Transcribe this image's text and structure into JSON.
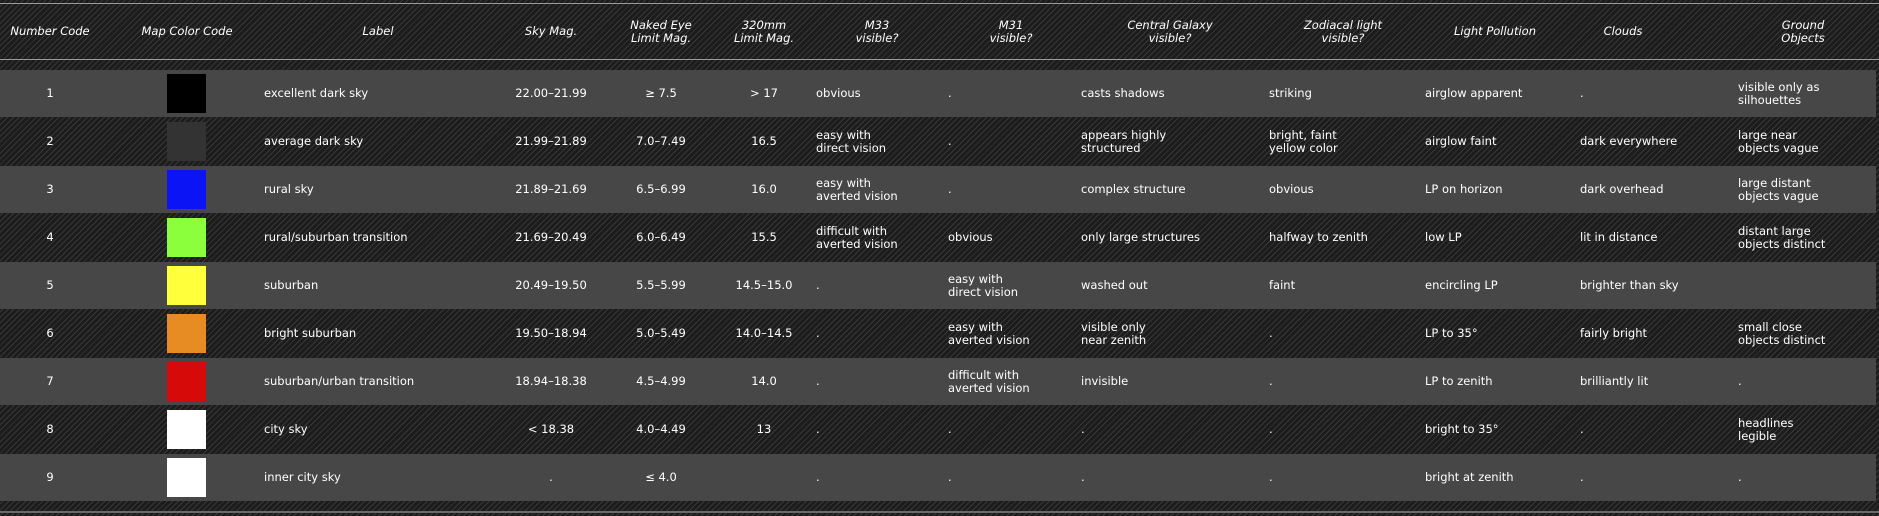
{
  "headers": [
    "Number Code",
    "Map Color Code",
    "Label",
    "Sky Mag.",
    "Naked Eye\nLimit Mag.",
    "320mm\nLimit Mag.",
    "M33\nvisible?",
    "M31\nvisible?",
    "Central Galaxy\nvisible?",
    "Zodiacal light\nvisible?",
    "Light Pollution",
    "Clouds",
    "Ground\nObjects"
  ],
  "rows": [
    {
      "number": "1",
      "color": "#000000",
      "label": "excellent dark sky",
      "sky_mag": "22.00–21.99",
      "naked_eye": "≥ 7.5",
      "limit_320mm": "> 17",
      "m33": "obvious",
      "m31": ".",
      "central_galaxy": "casts shadows",
      "zodiacal": "striking",
      "light_pollution": "airglow apparent",
      "clouds": ".",
      "ground": "visible only as\nsilhouettes"
    },
    {
      "number": "2",
      "color": "#333333",
      "label": "average dark sky",
      "sky_mag": "21.99–21.89",
      "naked_eye": "7.0–7.49",
      "limit_320mm": "16.5",
      "m33": "easy with\ndirect vision",
      "m31": ".",
      "central_galaxy": "appears highly\nstructured",
      "zodiacal": "bright, faint\nyellow color",
      "light_pollution": "airglow faint",
      "clouds": "dark everywhere",
      "ground": "large near\nobjects vague"
    },
    {
      "number": "3",
      "color": "#0a14f5",
      "label": "rural sky",
      "sky_mag": "21.89–21.69",
      "naked_eye": "6.5–6.99",
      "limit_320mm": "16.0",
      "m33": "easy with\naverted vision",
      "m31": ".",
      "central_galaxy": "complex structure",
      "zodiacal": "obvious",
      "light_pollution": "LP on horizon",
      "clouds": "dark overhead",
      "ground": "large distant\nobjects vague"
    },
    {
      "number": "4",
      "color": "#8cff3c",
      "label": "rural/suburban transition",
      "sky_mag": "21.69–20.49",
      "naked_eye": "6.0–6.49",
      "limit_320mm": "15.5",
      "m33": "difficult with\naverted vision",
      "m31": "obvious",
      "central_galaxy": "only large structures",
      "zodiacal": "halfway to zenith",
      "light_pollution": "low LP",
      "clouds": "lit in distance",
      "ground": "distant large\nobjects distinct"
    },
    {
      "number": "5",
      "color": "#ffff3c",
      "label": "suburban",
      "sky_mag": "20.49–19.50",
      "naked_eye": "5.5–5.99",
      "limit_320mm": "14.5–15.0",
      "m33": ".",
      "m31": "easy with\ndirect vision",
      "central_galaxy": "washed out",
      "zodiacal": "faint",
      "light_pollution": "encircling LP",
      "clouds": "brighter than sky",
      "ground": ""
    },
    {
      "number": "6",
      "color": "#e68c23",
      "label": "bright suburban",
      "sky_mag": "19.50–18.94",
      "naked_eye": "5.0–5.49",
      "limit_320mm": "14.0–14.5",
      "m33": ".",
      "m31": "easy with\naverted vision",
      "central_galaxy": "visible only\nnear zenith",
      "zodiacal": ".",
      "light_pollution": "LP to 35°",
      "clouds": "fairly bright",
      "ground": "small close\nobjects distinct"
    },
    {
      "number": "7",
      "color": "#d70a0a",
      "label": "suburban/urban transition",
      "sky_mag": "18.94–18.38",
      "naked_eye": "4.5–4.99",
      "limit_320mm": "14.0",
      "m33": ".",
      "m31": "difficult with\naverted vision",
      "central_galaxy": "invisible",
      "zodiacal": ".",
      "light_pollution": "LP to zenith",
      "clouds": "brilliantly lit",
      "ground": "."
    },
    {
      "number": "8",
      "color": "#ffffff",
      "label": "city sky",
      "sky_mag": "< 18.38",
      "naked_eye": "4.0–4.49",
      "limit_320mm": "13",
      "m33": ".",
      "m31": ".",
      "central_galaxy": ".",
      "zodiacal": ".",
      "light_pollution": "bright to 35°",
      "clouds": ".",
      "ground": "headlines\nlegible"
    },
    {
      "number": "9",
      "color": "#ffffff",
      "label": "inner city sky",
      "sky_mag": ".",
      "naked_eye": "≤ 4.0",
      "limit_320mm": "",
      "m33": ".",
      "m31": ".",
      "central_galaxy": ".",
      "zodiacal": ".",
      "light_pollution": "bright at zenith",
      "clouds": ".",
      "ground": "."
    }
  ]
}
